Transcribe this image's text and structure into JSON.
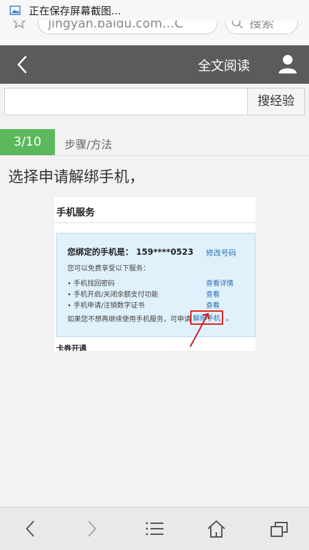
{
  "status_bar": {
    "notification": "正在保存屏幕截图..."
  },
  "browser": {
    "url": "jingyan.baidu.com…C",
    "search_label": "搜索"
  },
  "header": {
    "full_text_label": "全文阅读"
  },
  "search": {
    "placeholder": "",
    "button_label": "搜经验"
  },
  "step": {
    "badge": "3/10",
    "section_label": "步骤/方法",
    "text": "选择申请解绑手机，"
  },
  "embedded": {
    "title": "手机服务",
    "bound_label": "您绑定的手机是：  159****0523",
    "modify_link": "修改号码",
    "intro": "您可以免费享受以下服务：",
    "services": [
      {
        "label": "• 手机找回密码",
        "link": "查看详情"
      },
      {
        "label": "• 手机开启/关闭余额支付功能",
        "link": "查看"
      },
      {
        "label": "• 手机申请/注销数字证书",
        "link": "查看"
      }
    ],
    "note": "如果您不想再继续使用手机服务，可申请",
    "unbind_link": "解绑手机",
    "period": "。",
    "bottom_text": "卡券开通"
  },
  "colors": {
    "header_bg": "#5b5b5b",
    "step_badge": "#5cb85c",
    "link": "#2c6fb7",
    "highlight": "#e02020"
  }
}
